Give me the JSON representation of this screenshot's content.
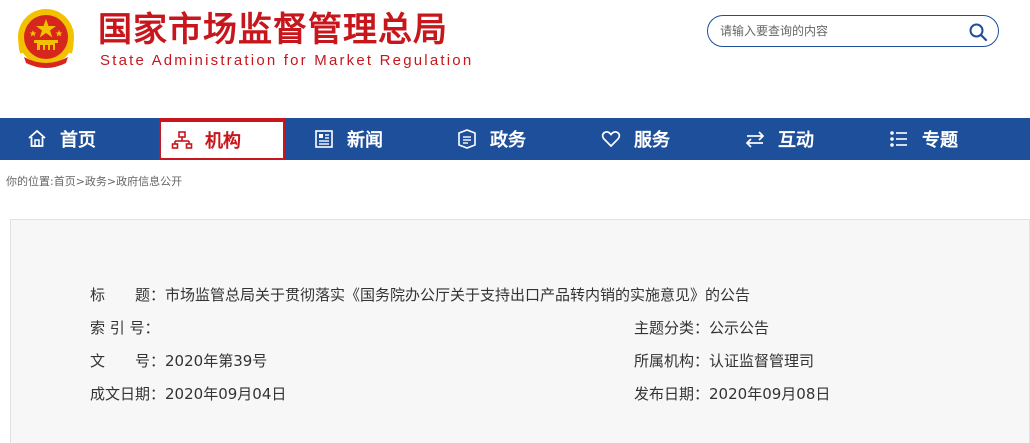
{
  "header": {
    "title_cn": "国家市场监督管理总局",
    "title_en": "State Administration for Market Regulation",
    "search_placeholder": "请输入要查询的内容"
  },
  "nav": [
    {
      "label": "首页",
      "icon": "home-icon",
      "active": false
    },
    {
      "label": "机构",
      "icon": "org-chart-icon",
      "active": true
    },
    {
      "label": "新闻",
      "icon": "news-icon",
      "active": false
    },
    {
      "label": "政务",
      "icon": "affairs-icon",
      "active": false
    },
    {
      "label": "服务",
      "icon": "heart-icon",
      "active": false
    },
    {
      "label": "互动",
      "icon": "exchange-icon",
      "active": false
    },
    {
      "label": "专题",
      "icon": "topic-icon",
      "active": false
    }
  ],
  "breadcrumb": "你的位置:首页>政务>政府信息公开",
  "info": {
    "title_label": "标　　题：",
    "title_value": "市场监管总局关于贯彻落实《国务院办公厅关于支持出口产品转内销的实施意见》的公告",
    "index_label": "索 引 号：",
    "index_value": "",
    "topic_label": "主题分类：",
    "topic_value": "公示公告",
    "docno_label": "文　　号：",
    "docno_value": "2020年第39号",
    "dept_label": "所属机构：",
    "dept_value": "认证监督管理司",
    "date_label": "成文日期：",
    "date_value": "2020年09月04日",
    "pubdate_label": "发布日期：",
    "pubdate_value": "2020年09月08日"
  },
  "colors": {
    "brand_red": "#c8161d",
    "nav_blue": "#1d4f9b",
    "emblem_gold": "#f2c200"
  }
}
